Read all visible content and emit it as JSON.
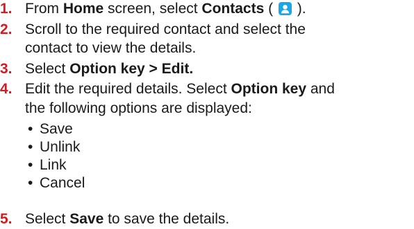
{
  "steps": [
    {
      "number": "1.",
      "parts": [
        "From ",
        "Home",
        " screen, select ",
        "Contacts",
        " ( ",
        " )."
      ],
      "icon": "contacts-icon"
    },
    {
      "number": "2.",
      "lines": [
        "Scroll to the required contact and select the",
        "contact to view the details."
      ]
    },
    {
      "number": "3.",
      "parts": [
        "Select ",
        "Option key > Edit."
      ]
    },
    {
      "number": "4.",
      "line1_parts": [
        "Edit the required details. Select ",
        "Option key",
        " and"
      ],
      "line2": "the following options are displayed:",
      "bullets": [
        "Save",
        "Unlink",
        "Link",
        "Cancel"
      ]
    },
    {
      "number": "5.",
      "parts": [
        "Select ",
        "Save",
        " to save the details."
      ]
    }
  ],
  "colors": {
    "step_number": "#d71920",
    "icon_background": "#1aa7e8",
    "text": "#1a1a1a"
  }
}
